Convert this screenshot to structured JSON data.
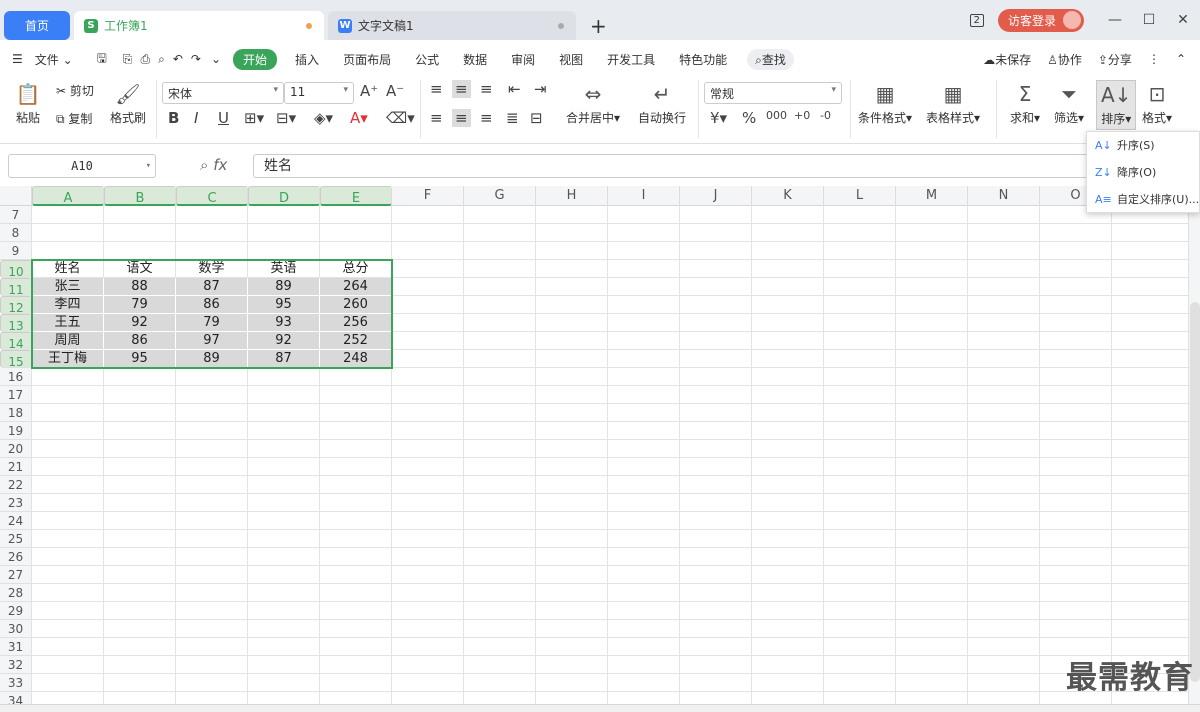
{
  "tabs": {
    "home": "首页",
    "book": "工作簿1",
    "doc": "文字文稿1",
    "book_icon": "S",
    "doc_icon": "W"
  },
  "window": {
    "screen_count": "2",
    "guest_label": "访客登录",
    "min": "—",
    "max": "☐",
    "close": "✕"
  },
  "menu": {
    "file": "文件",
    "items": [
      "开始",
      "插入",
      "页面布局",
      "公式",
      "数据",
      "审阅",
      "视图",
      "开发工具",
      "特色功能"
    ],
    "search": "查找",
    "unsaved": "未保存",
    "collab": "协作",
    "share": "分享"
  },
  "ribbon": {
    "paste": "粘贴",
    "cut": "剪切",
    "copy": "复制",
    "format_painter": "格式刷",
    "font": "宋体",
    "font_size": "11",
    "bold": "B",
    "italic": "I",
    "underline": "U",
    "number_format": "常规",
    "merge": "合并居中",
    "wrap": "自动换行",
    "cond_format": "条件格式",
    "table_style": "表格样式",
    "sum": "求和",
    "filter": "筛选",
    "sort": "排序",
    "format": "格式"
  },
  "formula": {
    "cell_ref": "A10",
    "fx": "fx",
    "content": "姓名"
  },
  "sort_menu": {
    "asc": "升序(S)",
    "desc": "降序(O)",
    "custom": "自定义排序(U)..."
  },
  "columns": [
    "A",
    "B",
    "C",
    "D",
    "E",
    "F",
    "G",
    "H",
    "I",
    "J",
    "K",
    "L",
    "M",
    "N",
    "O"
  ],
  "rows": [
    "7",
    "8",
    "9",
    "10",
    "11",
    "12",
    "13",
    "14",
    "15",
    "16",
    "17",
    "18",
    "19",
    "20",
    "21",
    "22",
    "23",
    "24",
    "25",
    "26",
    "27",
    "28",
    "29",
    "30",
    "31",
    "32",
    "33",
    "34"
  ],
  "table": {
    "header": [
      "姓名",
      "语文",
      "数学",
      "英语",
      "总分"
    ],
    "data": [
      [
        "张三",
        "88",
        "87",
        "89",
        "264"
      ],
      [
        "李四",
        "79",
        "86",
        "95",
        "260"
      ],
      [
        "王五",
        "92",
        "79",
        "93",
        "256"
      ],
      [
        "周周",
        "86",
        "97",
        "92",
        "252"
      ],
      [
        "王丁梅",
        "95",
        "89",
        "87",
        "248"
      ]
    ]
  },
  "watermark": "最需教育",
  "colors": {
    "accent_green": "#3aa55a",
    "accent_blue": "#3a7ff6",
    "guest_red": "#e25c4c"
  }
}
